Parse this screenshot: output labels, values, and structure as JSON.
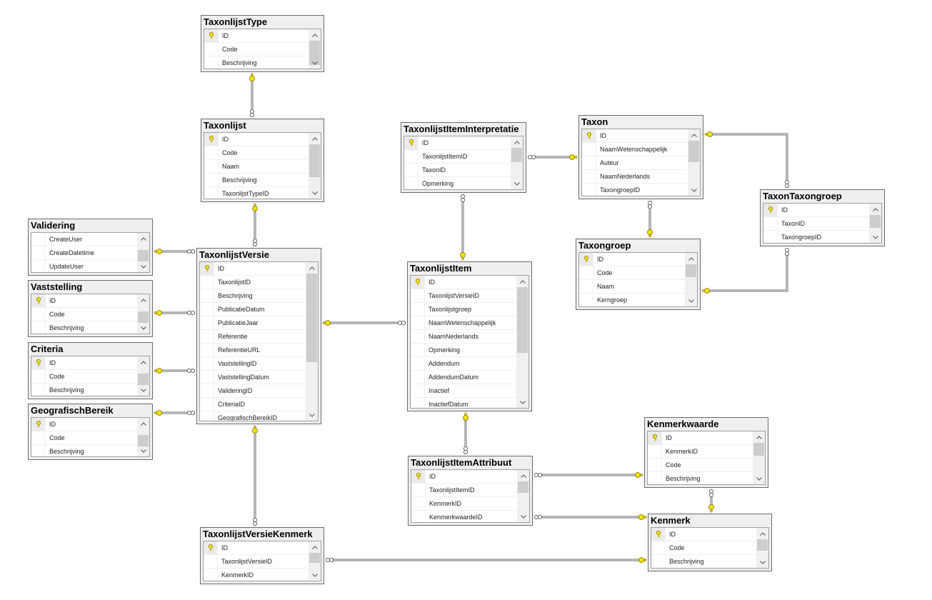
{
  "diagram": {
    "type": "database-diagram",
    "tables": [
      {
        "id": "TaxonlijstType",
        "title": "TaxonlijstType",
        "columns": [
          {
            "name": "ID",
            "pk": true
          },
          {
            "name": "Code"
          },
          {
            "name": "Beschrijving"
          }
        ]
      },
      {
        "id": "Taxonlijst",
        "title": "Taxonlijst",
        "columns": [
          {
            "name": "ID",
            "pk": true
          },
          {
            "name": "Code"
          },
          {
            "name": "Naam"
          },
          {
            "name": "Beschrijving"
          },
          {
            "name": "TaxonlijstTypeID"
          }
        ]
      },
      {
        "id": "Validering",
        "title": "Validering",
        "columns": [
          {
            "name": "CreateUser"
          },
          {
            "name": "CreateDatetime"
          },
          {
            "name": "UpdateUser"
          }
        ]
      },
      {
        "id": "Vaststelling",
        "title": "Vaststelling",
        "columns": [
          {
            "name": "ID",
            "pk": true
          },
          {
            "name": "Code"
          },
          {
            "name": "Beschrijving"
          }
        ]
      },
      {
        "id": "Criteria",
        "title": "Criteria",
        "columns": [
          {
            "name": "ID",
            "pk": true
          },
          {
            "name": "Code"
          },
          {
            "name": "Beschrijving"
          }
        ]
      },
      {
        "id": "GeografischBereik",
        "title": "GeografischBereik",
        "columns": [
          {
            "name": "ID",
            "pk": true
          },
          {
            "name": "Code"
          },
          {
            "name": "Beschrijving"
          }
        ]
      },
      {
        "id": "TaxonlijstVersie",
        "title": "TaxonlijstVersie",
        "columns": [
          {
            "name": "ID",
            "pk": true
          },
          {
            "name": "TaxonlijstID"
          },
          {
            "name": "Beschrijving"
          },
          {
            "name": "PublicatieDatum"
          },
          {
            "name": "PublicatieJaar"
          },
          {
            "name": "Referentie"
          },
          {
            "name": "ReferentieURL"
          },
          {
            "name": "VaststellingID"
          },
          {
            "name": "VaststellingDatum"
          },
          {
            "name": "ValideringID"
          },
          {
            "name": "CriteriaID"
          },
          {
            "name": "GeografischBereikID"
          }
        ]
      },
      {
        "id": "TaxonlijstVersieKenmerk",
        "title": "TaxonlijstVersieKenmerk",
        "columns": [
          {
            "name": "ID",
            "pk": true
          },
          {
            "name": "TaxonlijstVersieID"
          },
          {
            "name": "KenmerkID"
          }
        ]
      },
      {
        "id": "TaxonlijstItemInterpretatie",
        "title": "TaxonlijstItemInterpretatie",
        "columns": [
          {
            "name": "ID",
            "pk": true
          },
          {
            "name": "TaxonlijstItemID"
          },
          {
            "name": "TaxonID"
          },
          {
            "name": "Opmerking"
          }
        ]
      },
      {
        "id": "TaxonlijstItem",
        "title": "TaxonlijstItem",
        "columns": [
          {
            "name": "ID",
            "pk": true
          },
          {
            "name": "TaxonlijstVersieID"
          },
          {
            "name": "Taxonlijstgroep"
          },
          {
            "name": "NaamWetenschappelijk"
          },
          {
            "name": "NaamNederlands"
          },
          {
            "name": "Opmerking"
          },
          {
            "name": "Addendum"
          },
          {
            "name": "AddendumDatum"
          },
          {
            "name": "Inactief"
          },
          {
            "name": "InactiefDatum"
          }
        ]
      },
      {
        "id": "TaxonlijstItemAttribuut",
        "title": "TaxonlijstItemAttribuut",
        "columns": [
          {
            "name": "ID",
            "pk": true
          },
          {
            "name": "TaxonlijstItemID"
          },
          {
            "name": "KenmerkID"
          },
          {
            "name": "KenmerkwaardeID"
          }
        ]
      },
      {
        "id": "Taxon",
        "title": "Taxon",
        "columns": [
          {
            "name": "ID",
            "pk": true
          },
          {
            "name": "NaamWetenschappelijk"
          },
          {
            "name": "Auteur"
          },
          {
            "name": "NaamNederlands"
          },
          {
            "name": "TaxongroepID"
          }
        ]
      },
      {
        "id": "Taxongroep",
        "title": "Taxongroep",
        "columns": [
          {
            "name": "ID",
            "pk": true
          },
          {
            "name": "Code"
          },
          {
            "name": "Naam"
          },
          {
            "name": "Kerngroep"
          }
        ]
      },
      {
        "id": "TaxonTaxongroep",
        "title": "TaxonTaxongroep",
        "columns": [
          {
            "name": "ID",
            "pk": true
          },
          {
            "name": "TaxonID"
          },
          {
            "name": "TaxongroepID"
          }
        ]
      },
      {
        "id": "Kenmerkwaarde",
        "title": "Kenmerkwaarde",
        "columns": [
          {
            "name": "ID",
            "pk": true
          },
          {
            "name": "KenmerkID"
          },
          {
            "name": "Code"
          },
          {
            "name": "Beschrijving"
          }
        ]
      },
      {
        "id": "Kenmerk",
        "title": "Kenmerk",
        "columns": [
          {
            "name": "ID",
            "pk": true
          },
          {
            "name": "Code"
          },
          {
            "name": "Beschrijving"
          }
        ]
      }
    ],
    "relationships": [
      {
        "one": "TaxonlijstType",
        "many": "Taxonlijst"
      },
      {
        "one": "Taxonlijst",
        "many": "TaxonlijstVersie"
      },
      {
        "one": "Validering",
        "many": "TaxonlijstVersie"
      },
      {
        "one": "Vaststelling",
        "many": "TaxonlijstVersie"
      },
      {
        "one": "Criteria",
        "many": "TaxonlijstVersie"
      },
      {
        "one": "GeografischBereik",
        "many": "TaxonlijstVersie"
      },
      {
        "one": "TaxonlijstVersie",
        "many": "TaxonlijstItem"
      },
      {
        "one": "TaxonlijstVersie",
        "many": "TaxonlijstVersieKenmerk"
      },
      {
        "one": "TaxonlijstItem",
        "many": "TaxonlijstItemInterpretatie"
      },
      {
        "one": "TaxonlijstItem",
        "many": "TaxonlijstItemAttribuut"
      },
      {
        "one": "Taxon",
        "many": "TaxonlijstItemInterpretatie"
      },
      {
        "one": "Taxongroep",
        "many": "Taxon"
      },
      {
        "one": "Taxon",
        "many": "TaxonTaxongroep"
      },
      {
        "one": "Taxongroep",
        "many": "TaxonTaxongroep"
      },
      {
        "one": "Kenmerkwaarde",
        "many": "TaxonlijstItemAttribuut"
      },
      {
        "one": "Kenmerk",
        "many": "TaxonlijstItemAttribuut"
      },
      {
        "one": "Kenmerk",
        "many": "Kenmerkwaarde"
      },
      {
        "one": "Kenmerk",
        "many": "TaxonlijstVersieKenmerk"
      }
    ],
    "colors": {
      "key": "#f5e400",
      "line": "#6b6b6b",
      "header_bg": "#efefef",
      "scroll_thumb": "#cdcdcd"
    }
  }
}
